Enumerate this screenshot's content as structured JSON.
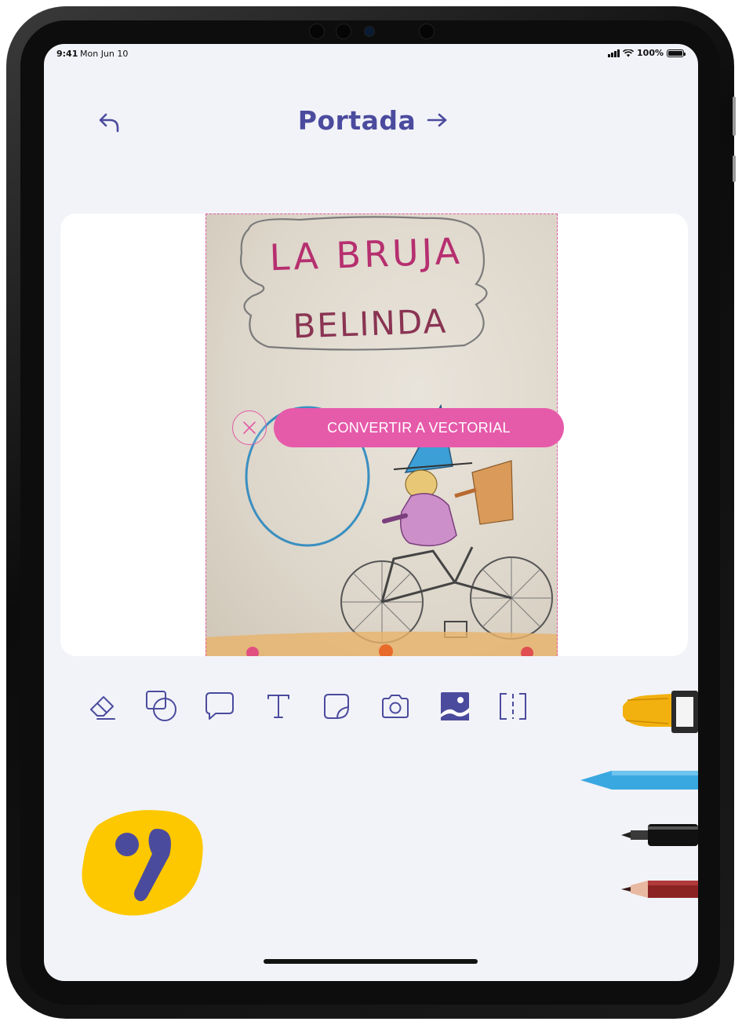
{
  "status_bar": {
    "time": "9:41",
    "date": "Mon Jun 10",
    "battery": "100%"
  },
  "header": {
    "title": "Portada",
    "back_icon": "undo-arrow-icon",
    "next_icon": "right-arrow-icon"
  },
  "canvas": {
    "drawing_text_line1": "LA BRUJA",
    "drawing_text_line2": "BELINDA",
    "convert_button_label": "CONVERTIR A VECTORIAL",
    "close_icon": "close-icon"
  },
  "toolbar": {
    "tools": [
      {
        "name": "eraser",
        "icon": "eraser-icon"
      },
      {
        "name": "shapes",
        "icon": "shapes-icon"
      },
      {
        "name": "speech-bubble",
        "icon": "speech-bubble-icon"
      },
      {
        "name": "text",
        "icon": "text-icon"
      },
      {
        "name": "sticker",
        "icon": "sticker-icon"
      },
      {
        "name": "camera",
        "icon": "camera-icon"
      },
      {
        "name": "image",
        "icon": "image-icon",
        "active": true
      },
      {
        "name": "scan",
        "icon": "scan-icon"
      }
    ]
  },
  "drawing_tools": [
    "paintbrush-icon",
    "crayon-icon",
    "marker-icon",
    "pencil-icon"
  ],
  "colors": {
    "accent_pink": "#e65aaa",
    "primary_indigo": "#4b4b9e",
    "background": "#f2f3f8",
    "logo_yellow": "#fdc800"
  }
}
